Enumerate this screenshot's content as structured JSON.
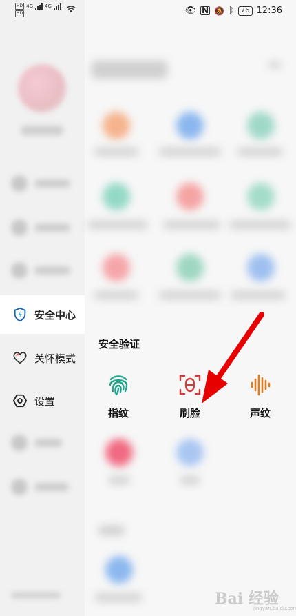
{
  "status_bar": {
    "network_1": "4G",
    "network_2": "4G",
    "hd_1": "HD",
    "hd_2": "HD",
    "battery": "76",
    "time": "12:36"
  },
  "sidebar": {
    "items": [
      {
        "label": "安全中心",
        "icon": "shield-icon",
        "active": true
      },
      {
        "label": "关怀模式",
        "icon": "heart-icon",
        "active": false
      },
      {
        "label": "设置",
        "icon": "hexagon-gear-icon",
        "active": false
      }
    ]
  },
  "section": {
    "title": "安全验证",
    "items": [
      {
        "label": "指纹",
        "icon": "fingerprint-icon",
        "color": "#1fa38a"
      },
      {
        "label": "刷脸",
        "icon": "face-scan-icon",
        "color": "#d23a3a"
      },
      {
        "label": "声纹",
        "icon": "voiceprint-icon",
        "color": "#e07b1e"
      }
    ]
  },
  "watermark": {
    "text": "Bai 经验",
    "url": "jingyan.baidu.com"
  },
  "colors": {
    "annotation_arrow": "#e60000"
  }
}
